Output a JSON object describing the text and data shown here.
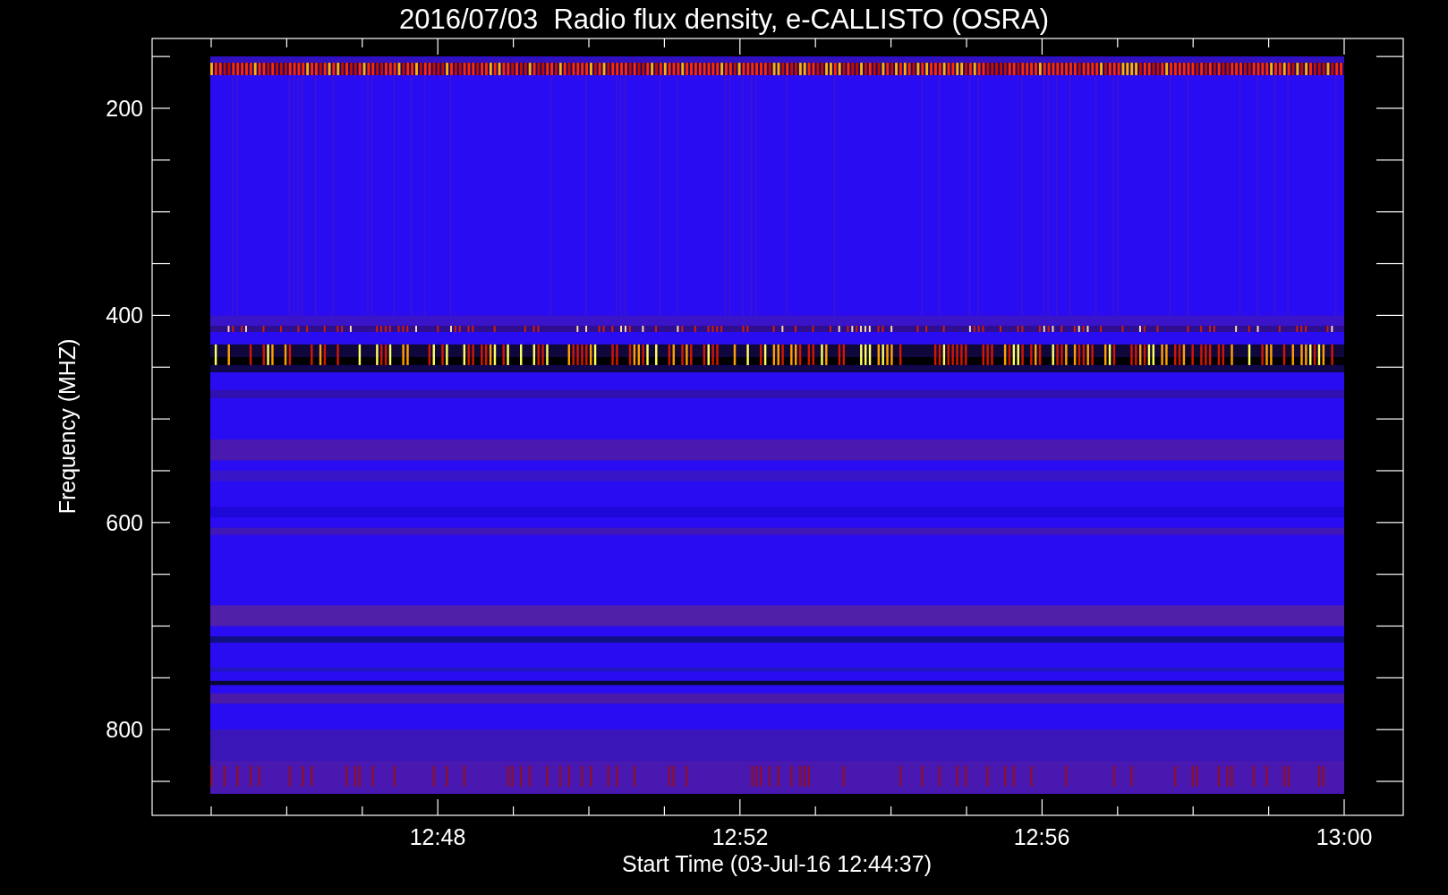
{
  "title": "2016/07/03  Radio flux density, e-CALLISTO (OSRA)",
  "y_axis": {
    "label": "Frequency (MHZ)",
    "ticks": [
      "200",
      "400",
      "600",
      "800"
    ]
  },
  "x_axis": {
    "label": "Start Time (03-Jul-16 12:44:37)",
    "ticks": [
      "12:48",
      "12:52",
      "12:56",
      "13:00"
    ]
  }
}
